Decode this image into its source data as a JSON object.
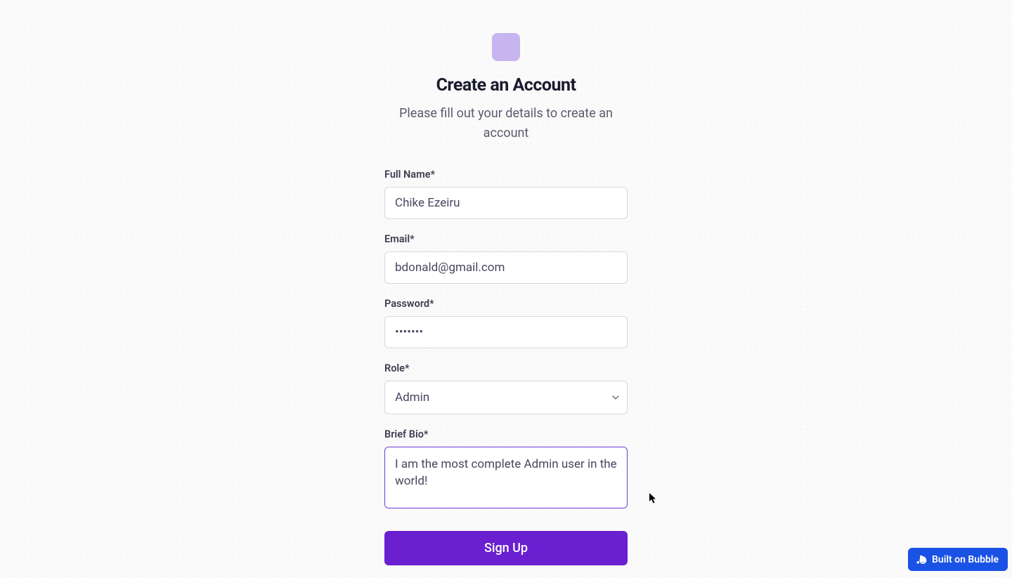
{
  "header": {
    "title": "Create an Account",
    "subtitle": "Please fill out your details to create an account"
  },
  "form": {
    "fullname": {
      "label": "Full Name*",
      "value": "Chike Ezeiru"
    },
    "email": {
      "label": "Email*",
      "value": "bdonald@gmail.com"
    },
    "password": {
      "label": "Password*",
      "value": "•••••••"
    },
    "role": {
      "label": "Role*",
      "selected": "Admin"
    },
    "bio": {
      "label": "Brief Bio*",
      "value": "I am the most complete Admin user in the world!"
    },
    "submit_label": "Sign Up"
  },
  "badge": {
    "label": "Built on Bubble"
  }
}
